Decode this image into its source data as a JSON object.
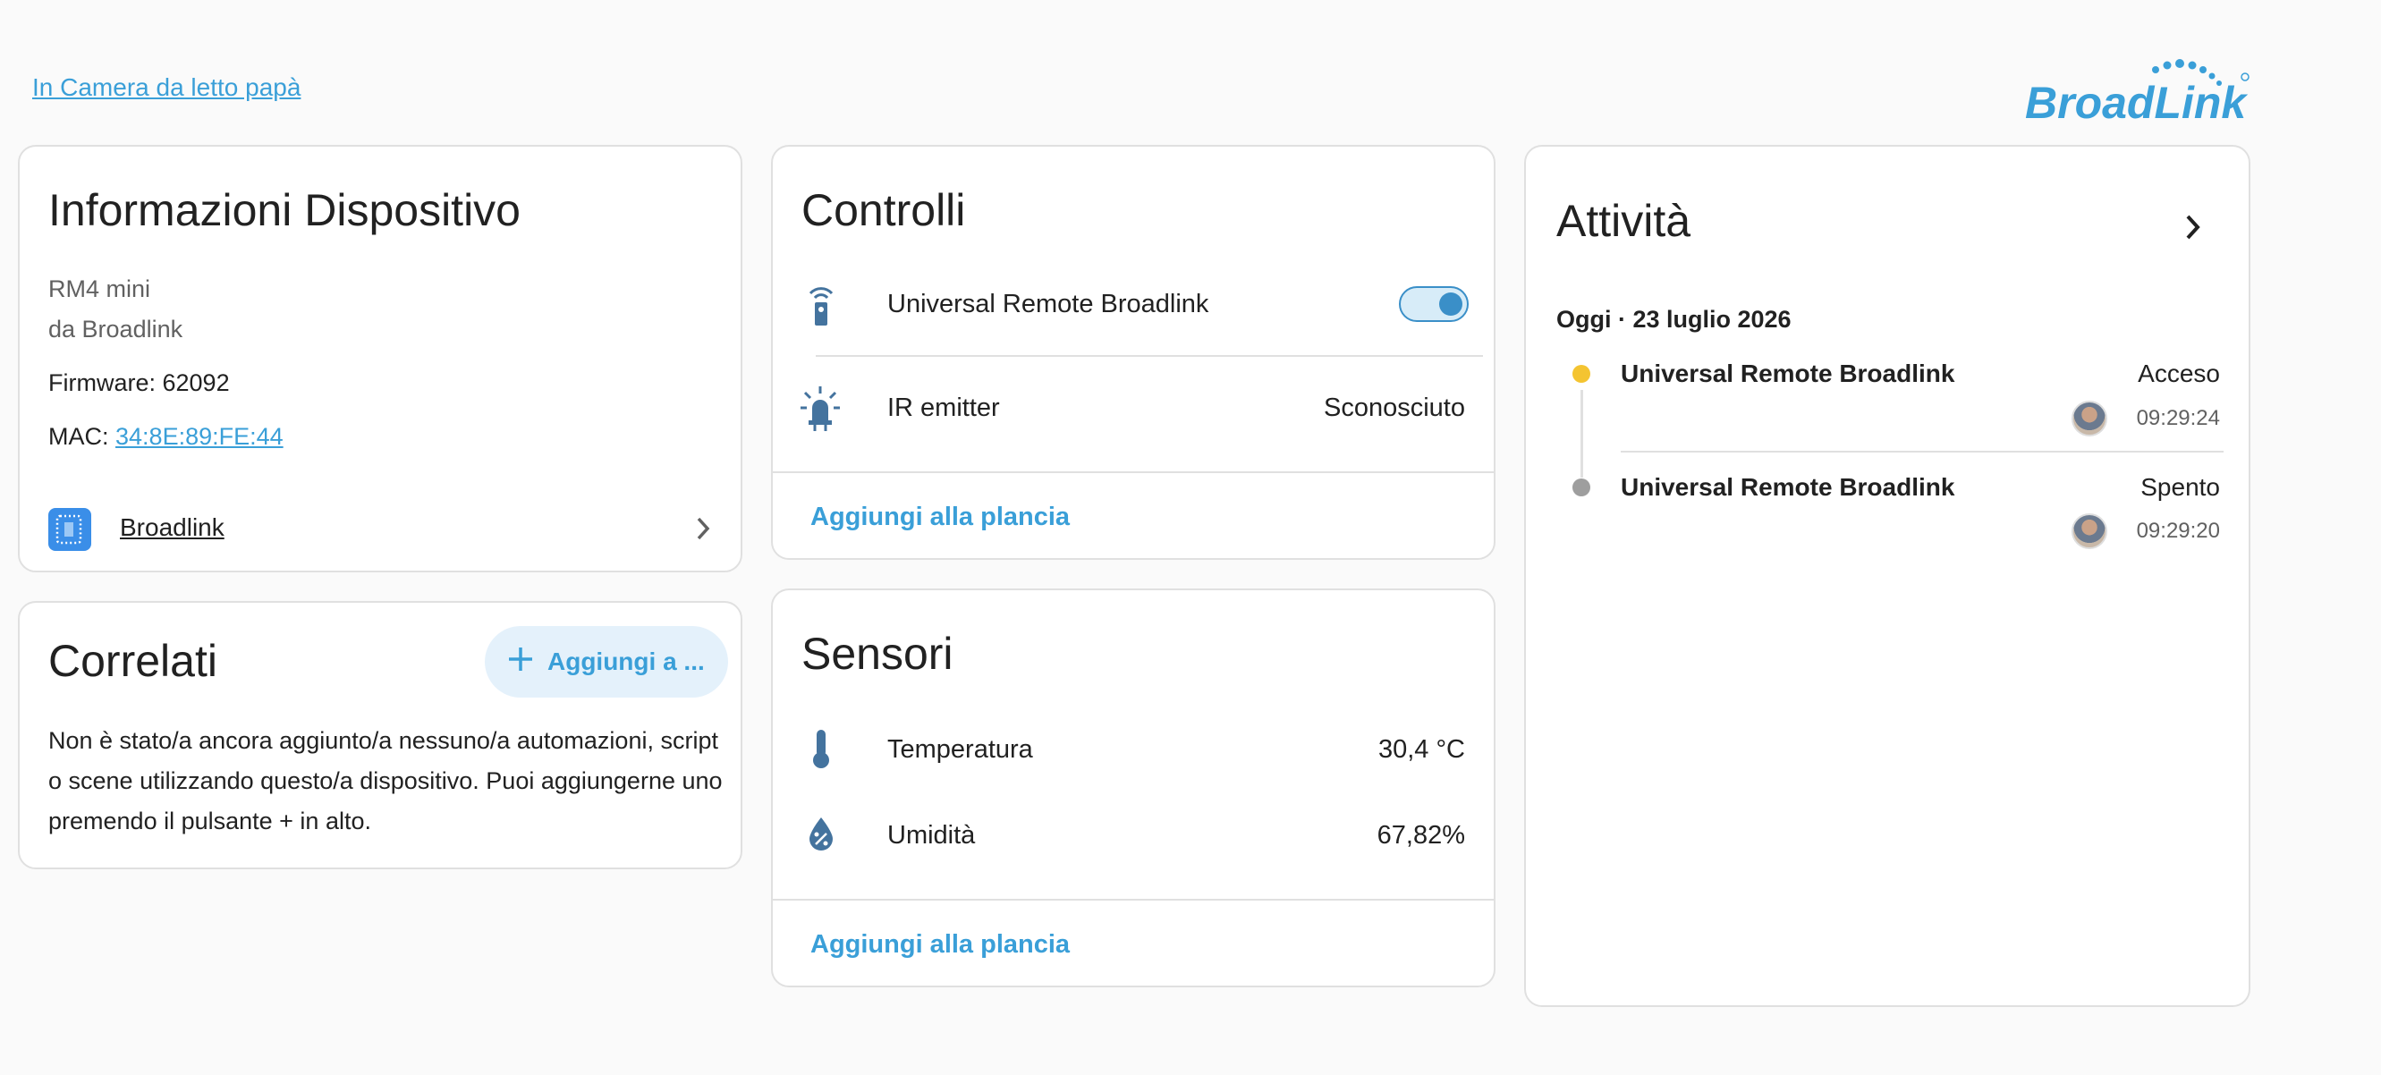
{
  "breadcrumb": "In Camera da letto papà",
  "logo": {
    "text": "BroadLink",
    "color": "#3a9fd8"
  },
  "device_info": {
    "title": "Informazioni Dispositivo",
    "model": "RM4 mini",
    "manufacturer": "da Broadlink",
    "firmware": "Firmware: 62092",
    "mac_label": "MAC:",
    "mac_value": "34:8E:89:FE:44",
    "integration_label": "Broadlink",
    "integration_icon": "broadlink-icon"
  },
  "related": {
    "title": "Correlati",
    "add_button": "Aggiungi a ...",
    "description": "Non è stato/a ancora aggiunto/a nessuno/a automazioni, script o scene utilizzando questo/a dispositivo. Puoi aggiungerne uno premendo il pulsante + in alto."
  },
  "controls": {
    "title": "Controlli",
    "items": [
      {
        "icon": "remote-icon",
        "label": "Universal Remote Broadlink",
        "state": "on"
      },
      {
        "icon": "ir-emitter-icon",
        "label": "IR emitter",
        "value": "Sconosciuto"
      }
    ],
    "add_to_dashboard": "Aggiungi alla plancia"
  },
  "sensors": {
    "title": "Sensori",
    "items": [
      {
        "icon": "thermometer-icon",
        "label": "Temperatura",
        "value": "30,4 °C"
      },
      {
        "icon": "humidity-icon",
        "label": "Umidità",
        "value": "67,82%"
      }
    ],
    "add_to_dashboard": "Aggiungi alla plancia"
  },
  "activity": {
    "title": "Attività",
    "date": "Oggi · 23 luglio 2026",
    "events": [
      {
        "name": "Universal Remote Broadlink",
        "state": "Acceso",
        "time": "09:29:24",
        "dot_color": "#f4c431"
      },
      {
        "name": "Universal Remote Broadlink",
        "state": "Spento",
        "time": "09:29:20",
        "dot_color": "#9e9e9e"
      }
    ]
  },
  "colors": {
    "accent": "#3a9fd8",
    "icon": "#44739e",
    "background": "#fafafa"
  }
}
